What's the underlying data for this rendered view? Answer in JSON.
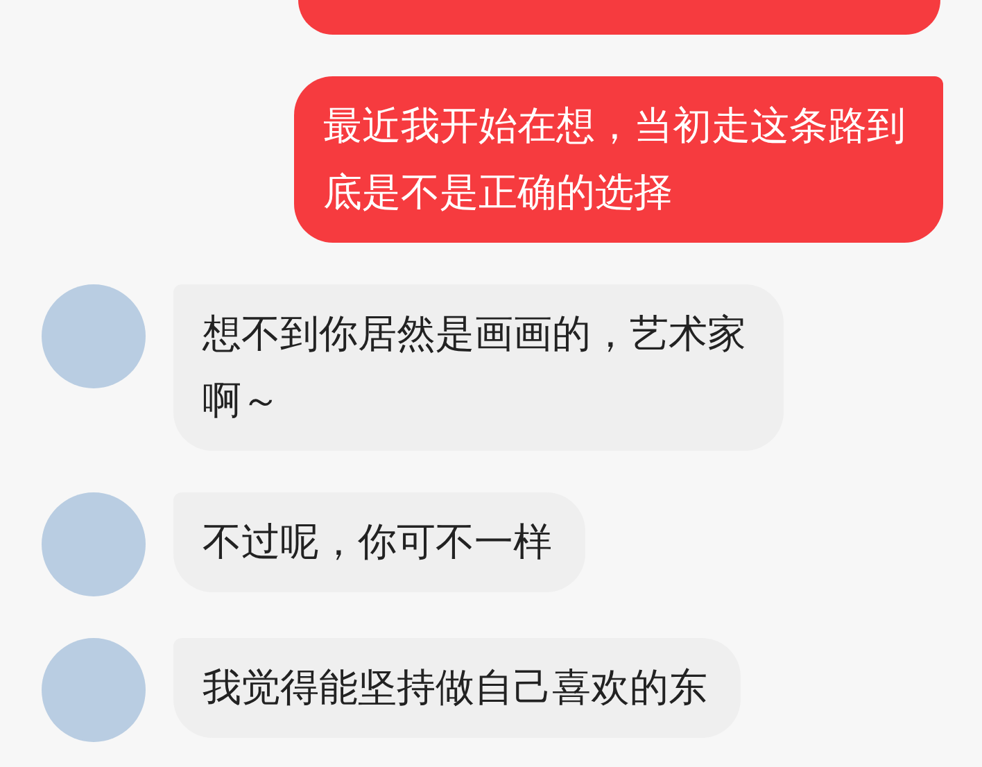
{
  "messages": [
    {
      "kind": "sent"
    },
    {
      "kind": "sent",
      "text": "最近我开始在想，当初走这条路到底是不是正确的选择"
    },
    {
      "kind": "received",
      "text": "想不到你居然是画画的，艺术家啊～"
    },
    {
      "kind": "received",
      "text": "不过呢，你可不一样"
    },
    {
      "kind": "received",
      "text": "我觉得能坚持做自己喜欢的东"
    }
  ]
}
